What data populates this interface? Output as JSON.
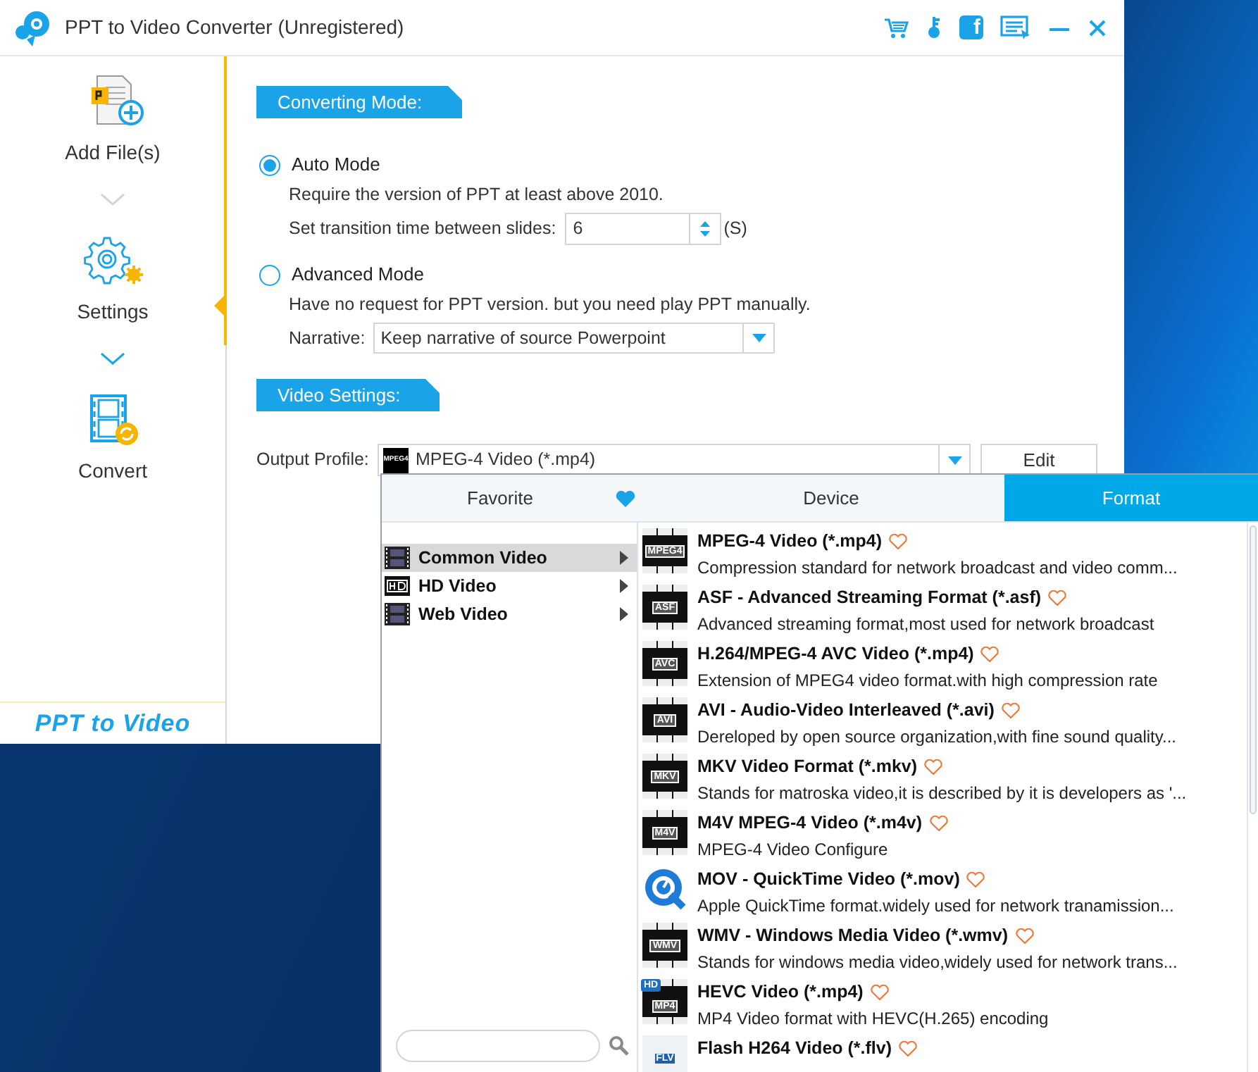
{
  "window": {
    "title": "PPT to Video Converter (Unregistered)",
    "social_glyph": "f"
  },
  "sidebar": {
    "items": [
      {
        "label": "Add File(s)",
        "kind": "add",
        "selected": false
      },
      {
        "label": "Settings",
        "kind": "settings",
        "selected": true
      },
      {
        "label": "Convert",
        "kind": "convert",
        "selected": false
      }
    ],
    "brand": "PPT to Video"
  },
  "converting_mode": {
    "header": "Converting Mode:",
    "modes": [
      {
        "label": "Auto Mode",
        "selected": true,
        "description": "Require the version of PPT at least above 2010.",
        "setting": {
          "kind": "spinner",
          "label": "Set transition time between slides:",
          "value": "6",
          "unit": "(S)"
        }
      },
      {
        "label": "Advanced Mode",
        "selected": false,
        "description": "Have no request for PPT version. but you need play PPT manually.",
        "setting": {
          "kind": "select",
          "label": "Narrative:",
          "value": "Keep narrative of source Powerpoint"
        }
      }
    ]
  },
  "video_settings": {
    "header": "Video Settings:",
    "output_profile": {
      "label": "Output Profile:",
      "value": "MPEG-4 Video (*.mp4)",
      "icon_label": "MPEG4"
    },
    "edit_button": "Edit"
  },
  "profile_menu": {
    "tabs": [
      {
        "label": "Favorite",
        "kind": "favorite",
        "selected": false
      },
      {
        "label": "Device",
        "kind": "device",
        "selected": false
      },
      {
        "label": "Format",
        "kind": "format",
        "selected": true
      }
    ],
    "categories": [
      {
        "label": "Common Video",
        "kind": "film",
        "selected": true
      },
      {
        "label": "HD Video",
        "kind": "hd",
        "selected": false
      },
      {
        "label": "Web Video",
        "kind": "film",
        "selected": false
      }
    ],
    "formats": [
      {
        "title": "MPEG-4 Video (*.mp4)",
        "description": "Compression standard for network broadcast and video comm...",
        "kind": "film",
        "icon_label": "MPEG4",
        "favorite": false
      },
      {
        "title": "ASF - Advanced Streaming Format (*.asf)",
        "description": "Advanced streaming format,most used for network broadcast",
        "kind": "film",
        "icon_label": "ASF",
        "favorite": false
      },
      {
        "title": "H.264/MPEG-4 AVC Video (*.mp4)",
        "description": "Extension of MPEG4 video format.with high compression rate",
        "kind": "film",
        "icon_label": "AVC",
        "favorite": false
      },
      {
        "title": "AVI - Audio-Video Interleaved (*.avi)",
        "description": "Dereloped by open source organization,with fine sound quality...",
        "kind": "film",
        "icon_label": "AVI",
        "favorite": false
      },
      {
        "title": "MKV Video Format (*.mkv)",
        "description": "Stands for matroska video,it is described by it is developers as '...",
        "kind": "film",
        "icon_label": "MKV",
        "favorite": false
      },
      {
        "title": "M4V MPEG-4 Video (*.m4v)",
        "description": "MPEG-4 Video Configure",
        "kind": "film",
        "icon_label": "M4V",
        "favorite": false
      },
      {
        "title": "MOV - QuickTime Video (*.mov)",
        "description": "Apple QuickTime format.widely used for network tranamission...",
        "kind": "quicktime",
        "favorite": false
      },
      {
        "title": "WMV - Windows Media Video (*.wmv)",
        "description": "Stands for windows media video,widely used for network trans...",
        "kind": "film",
        "icon_label": "WMV",
        "favorite": false
      },
      {
        "title": "HEVC Video (*.mp4)",
        "description": "MP4 Video format with HEVC(H.265) encoding",
        "kind": "hd",
        "icon_label": "MP4",
        "badge": "HD",
        "favorite": false
      },
      {
        "title": "Flash H264 Video (*.flv)",
        "kind": "flv",
        "icon_label": "FLV",
        "favorite": false
      }
    ]
  }
}
